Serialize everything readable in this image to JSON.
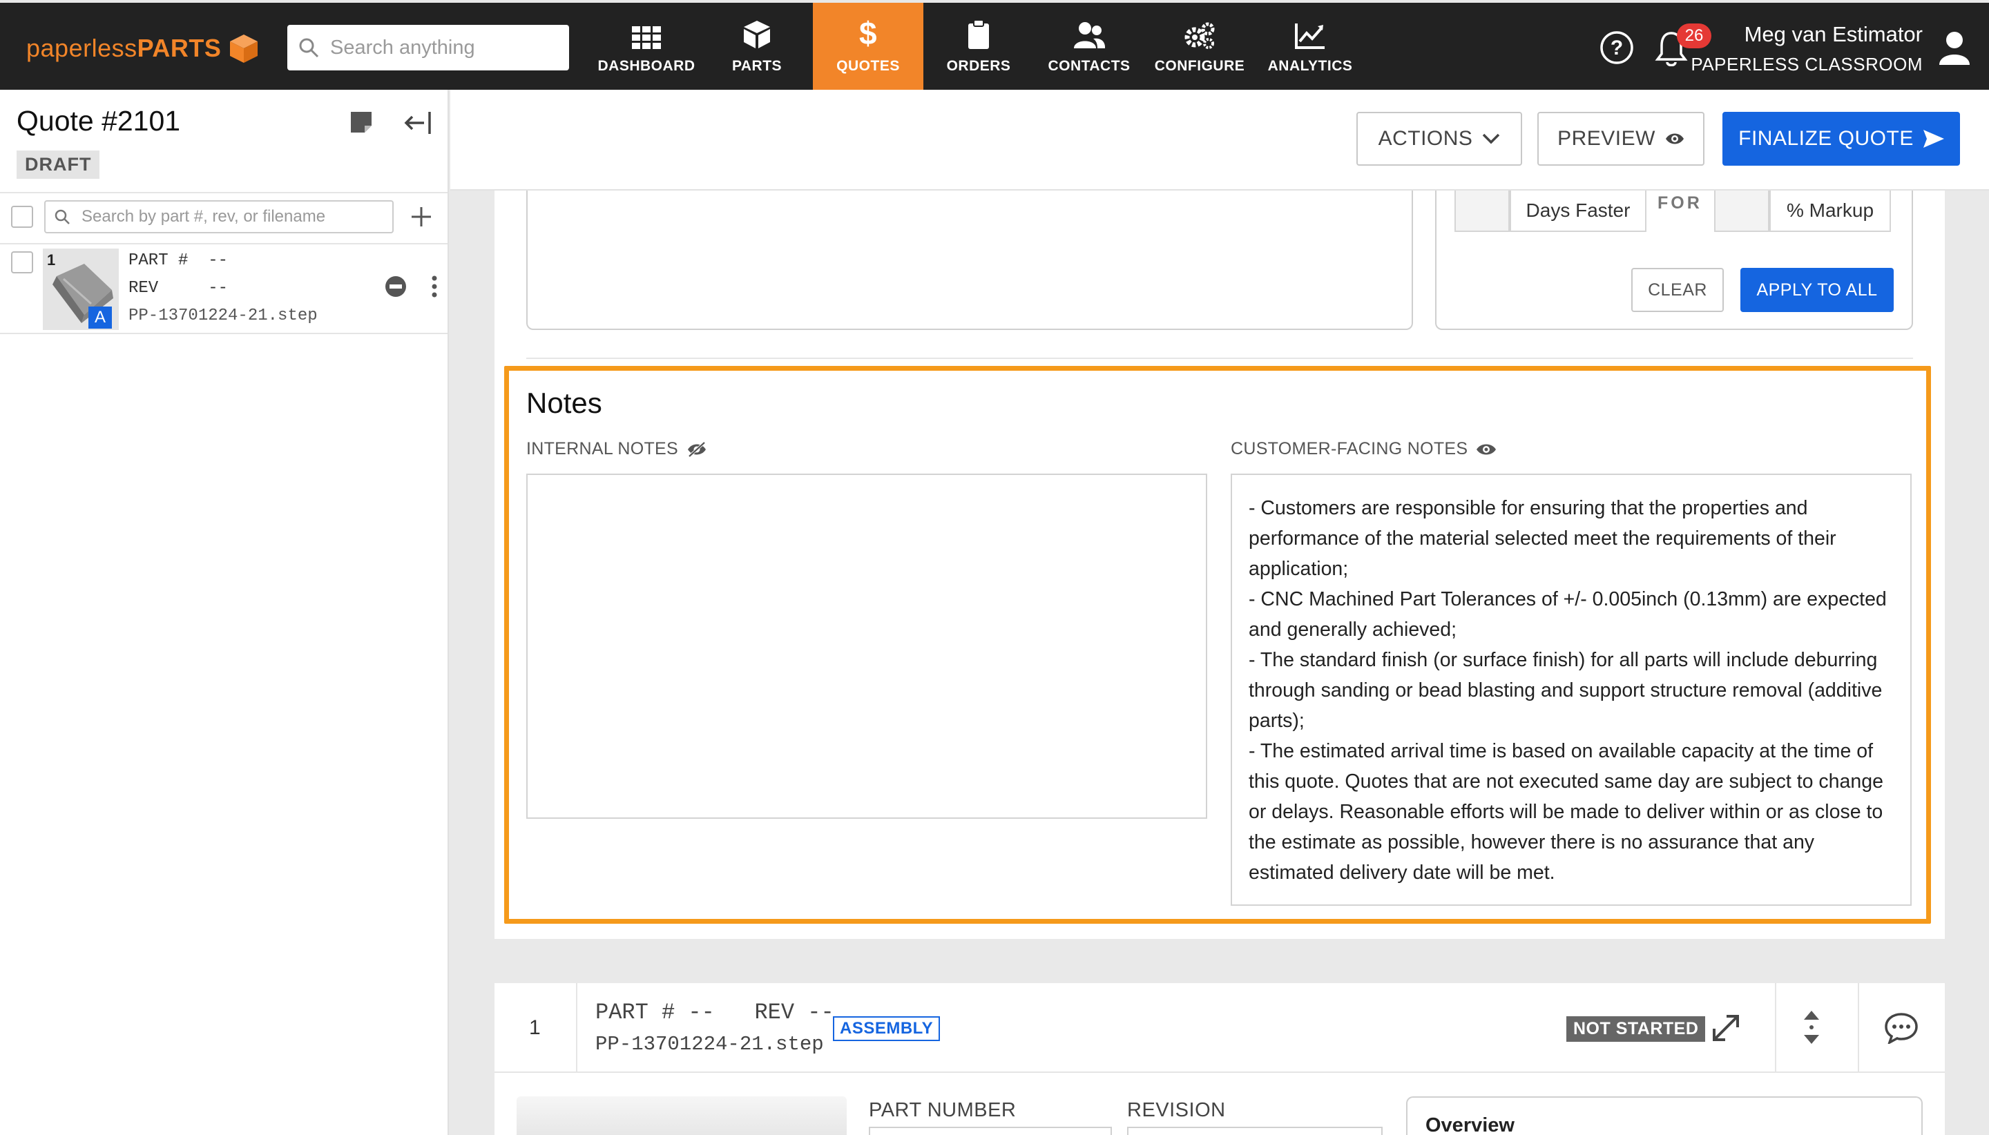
{
  "nav": {
    "logo_light": "paperless",
    "logo_bold": "PARTS",
    "search_placeholder": "Search anything",
    "items": [
      {
        "label": "DASHBOARD",
        "icon": "grid-icon"
      },
      {
        "label": "PARTS",
        "icon": "cube-icon"
      },
      {
        "label": "QUOTES",
        "icon": "dollar-icon"
      },
      {
        "label": "ORDERS",
        "icon": "clipboard-icon"
      },
      {
        "label": "CONTACTS",
        "icon": "people-icon"
      },
      {
        "label": "CONFIGURE",
        "icon": "gears-icon"
      },
      {
        "label": "ANALYTICS",
        "icon": "chart-icon"
      }
    ],
    "active": "QUOTES",
    "notification_count": "26",
    "user_name": "Meg van Estimator",
    "user_org": "PAPERLESS CLASSROOM",
    "colors": {
      "bar": "#222222",
      "accent": "#f28529"
    }
  },
  "sidebar": {
    "quote_title": "Quote #2101",
    "status": "DRAFT",
    "search_placeholder": "Search by part #, rev, or filename",
    "parts": [
      {
        "index": "1",
        "part_label": "PART #",
        "part_value": "--",
        "rev_label": "REV",
        "rev_value": "--",
        "filename": "PP-13701224-21.step",
        "badge": "A"
      }
    ]
  },
  "header": {
    "actions_label": "ACTIONS",
    "preview_label": "PREVIEW",
    "finalize_label": "FINALIZE QUOTE"
  },
  "pricing": {
    "days_faster_label": "Days Faster",
    "for_label": "FOR",
    "markup_label": "% Markup",
    "clear_label": "CLEAR",
    "apply_label": "APPLY TO ALL"
  },
  "notes": {
    "title": "Notes",
    "internal_label": "INTERNAL NOTES",
    "internal_value": "",
    "customer_label": "CUSTOMER-FACING NOTES",
    "customer_lines": [
      "- Customers are responsible for ensuring that the properties and performance of the material selected meet the requirements of their application;",
      "- CNC Machined Part Tolerances of +/- 0.005inch (0.13mm) are expected and generally achieved;",
      "- The standard finish (or surface finish) for all parts will include deburring through sanding or bead blasting and support structure removal (additive parts);",
      "- The estimated arrival time is based on available capacity at the time of this quote. Quotes that are not executed same day are subject to change or delays. Reasonable efforts will be made to deliver within or as close to the estimate as possible, however there is no assurance that any estimated delivery date will be met."
    ]
  },
  "part_card": {
    "index": "1",
    "part_label": "PART #",
    "part_value": "--",
    "rev_label": "REV",
    "rev_value": "--",
    "type_badge": "ASSEMBLY",
    "filename": "PP-13701224-21.step",
    "status": "NOT STARTED",
    "part_number_label": "PART NUMBER",
    "revision_label": "REVISION",
    "overview_tab": "Overview"
  }
}
